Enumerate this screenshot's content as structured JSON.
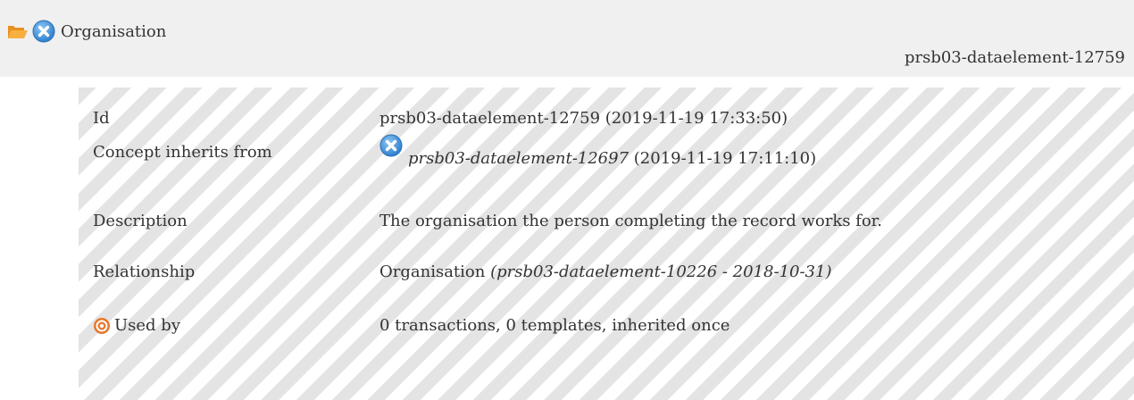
{
  "header": {
    "title": "Organisation",
    "id": "prsb03-dataelement-12759"
  },
  "details": {
    "id": {
      "label": "Id",
      "value": "prsb03-dataelement-12759 (2019-11-19 17:33:50)"
    },
    "inherits": {
      "label": "Concept inherits from",
      "link": "prsb03-dataelement-12697",
      "date": " (2019-11-19 17:11:10)"
    },
    "description": {
      "label": "Description",
      "value": "The organisation the person completing the record works for."
    },
    "relationship": {
      "label": "Relationship",
      "name": "Organisation",
      "ref": " (prsb03-dataelement-10226 - 2018-10-31)"
    },
    "used_by": {
      "label": "Used by",
      "value": "0 transactions, 0 templates, inherited once"
    }
  },
  "icons": {
    "folder": "folder-open-icon",
    "status": "cancelled-x-icon",
    "used_by": "target-icon"
  },
  "colors": {
    "folder": "#f0a030",
    "status_x": "#3a8fd8",
    "target": "#e8762a"
  }
}
